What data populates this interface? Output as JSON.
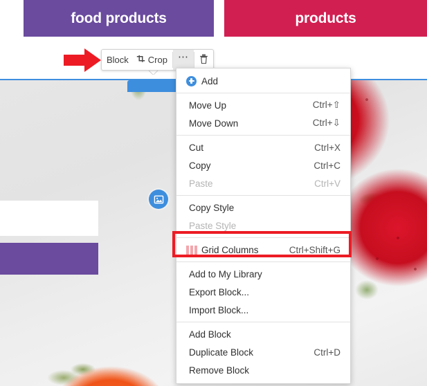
{
  "hero": {
    "blocks": [
      {
        "label": "food products",
        "color": "#6a4b9e"
      },
      {
        "label": "products",
        "color": "#d21f52"
      }
    ]
  },
  "toolbar": {
    "block_label": "Block",
    "crop_label": "Crop",
    "crop_icon": "crop-icon",
    "more_label": "•••",
    "more_icon": "ellipsis-icon",
    "delete_icon": "trash-icon"
  },
  "annotation": {
    "arrow_icon": "red-arrow-icon",
    "arrow_color": "#ed1b24",
    "highlight_color": "#ed1b24",
    "highlight_target": "Grid Columns"
  },
  "canvas": {
    "image_badge_icon": "image-icon",
    "selection_color": "#3e8ede",
    "left_purple_color": "#6a4b9e"
  },
  "context_menu": {
    "groups": [
      {
        "items": [
          {
            "label": "Add",
            "shortcut": "",
            "icon": "add-circle-icon",
            "disabled": false
          }
        ]
      },
      {
        "items": [
          {
            "label": "Move Up",
            "shortcut": "Ctrl+⇧",
            "icon": "",
            "disabled": false
          },
          {
            "label": "Move Down",
            "shortcut": "Ctrl+⇩",
            "icon": "",
            "disabled": false
          }
        ]
      },
      {
        "items": [
          {
            "label": "Cut",
            "shortcut": "Ctrl+X",
            "icon": "",
            "disabled": false
          },
          {
            "label": "Copy",
            "shortcut": "Ctrl+C",
            "icon": "",
            "disabled": false
          },
          {
            "label": "Paste",
            "shortcut": "Ctrl+V",
            "icon": "",
            "disabled": true
          }
        ]
      },
      {
        "items": [
          {
            "label": "Copy Style",
            "shortcut": "",
            "icon": "",
            "disabled": false
          },
          {
            "label": "Paste Style",
            "shortcut": "",
            "icon": "",
            "disabled": true
          }
        ]
      },
      {
        "items": [
          {
            "label": "Grid Columns",
            "shortcut": "Ctrl+Shift+G",
            "icon": "grid-columns-icon",
            "disabled": false
          }
        ]
      },
      {
        "items": [
          {
            "label": "Add to My Library",
            "shortcut": "",
            "icon": "",
            "disabled": false
          },
          {
            "label": "Export Block...",
            "shortcut": "",
            "icon": "",
            "disabled": false
          },
          {
            "label": "Import Block...",
            "shortcut": "",
            "icon": "",
            "disabled": false
          }
        ]
      },
      {
        "items": [
          {
            "label": "Add Block",
            "shortcut": "",
            "icon": "",
            "disabled": false
          },
          {
            "label": "Duplicate Block",
            "shortcut": "Ctrl+D",
            "icon": "",
            "disabled": false
          },
          {
            "label": "Remove Block",
            "shortcut": "",
            "icon": "",
            "disabled": false
          }
        ]
      }
    ]
  }
}
